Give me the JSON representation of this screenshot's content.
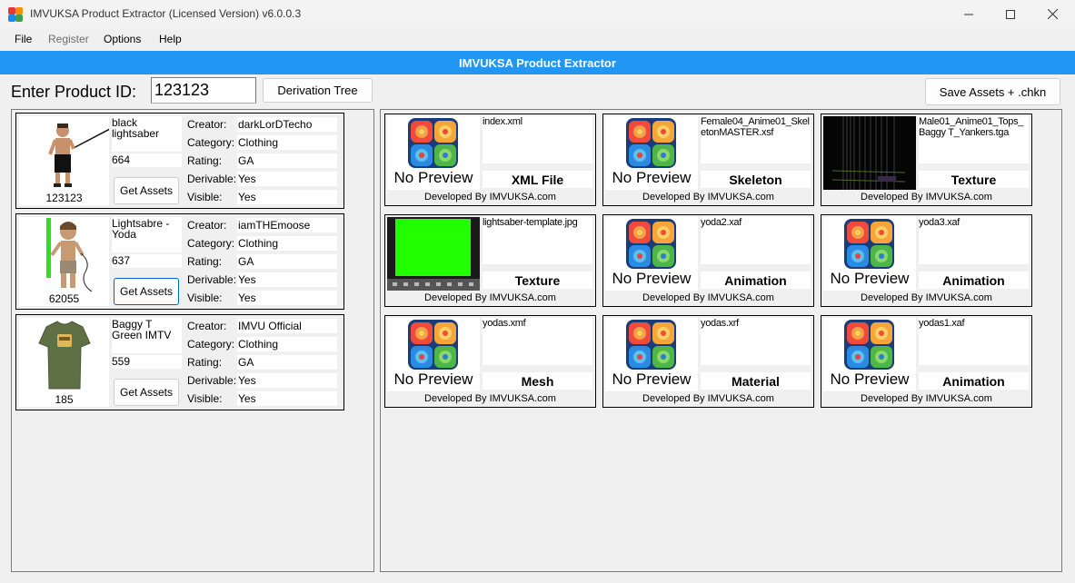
{
  "window": {
    "title": "IMVUKSA Product Extractor (Licensed Version) v6.0.0.3",
    "icon": "app-logo-icon",
    "controls": [
      "minimize-icon",
      "maximize-icon",
      "close-icon"
    ]
  },
  "menu": {
    "file": "File",
    "register": "Register",
    "options": "Options",
    "help": "Help"
  },
  "header": {
    "title": "IMVUKSA Product Extractor",
    "color": "#2196f3"
  },
  "toolbar": {
    "product_id_label": "Enter Product ID:",
    "product_id_value": "123123",
    "derivation_tree": "Derivation Tree",
    "save_assets": "Save Assets + .chkn"
  },
  "labels": {
    "creator": "Creator:",
    "category": "Category:",
    "rating": "Rating:",
    "derivable": "Derivable:",
    "visible": "Visible:",
    "get_assets": "Get Assets",
    "no_preview": "No Preview",
    "developed_by": "Developed By IMVUKSA.com"
  },
  "products": [
    {
      "id": "123123",
      "name": "black lightsaber",
      "count": "664",
      "creator": "darkLorDTecho",
      "category": "Clothing",
      "rating": "GA",
      "derivable": "Yes",
      "visible": "Yes",
      "thumb": "avatar-with-black-lightsaber"
    },
    {
      "id": "62055",
      "name": "Lightsabre - Yoda",
      "count": "637",
      "creator": "iamTHEmoose",
      "category": "Clothing",
      "rating": "GA",
      "derivable": "Yes",
      "visible": "Yes",
      "thumb": "avatar-with-green-lightsaber"
    },
    {
      "id": "185",
      "name": "Baggy T Green IMTV",
      "count": "559",
      "creator": "IMVU Official",
      "category": "Clothing",
      "rating": "GA",
      "derivable": "Yes",
      "visible": "Yes",
      "thumb": "green-tshirt"
    }
  ],
  "assets": [
    {
      "name": "index.xml",
      "type": "XML File",
      "preview": "no-preview"
    },
    {
      "name": "Female04_Anime01_SkeletonMASTER.xsf",
      "type": "Skeleton",
      "preview": "no-preview"
    },
    {
      "name": "Male01_Anime01_Tops_Baggy T_Yankers.tga",
      "type": "Texture",
      "preview": "dark-texture"
    },
    {
      "name": "lightsaber-template.jpg",
      "type": "Texture",
      "preview": "green-texture"
    },
    {
      "name": "yoda2.xaf",
      "type": "Animation",
      "preview": "no-preview"
    },
    {
      "name": "yoda3.xaf",
      "type": "Animation",
      "preview": "no-preview"
    },
    {
      "name": "yodas.xmf",
      "type": "Mesh",
      "preview": "no-preview"
    },
    {
      "name": "yodas.xrf",
      "type": "Material",
      "preview": "no-preview"
    },
    {
      "name": "yodas1.xaf",
      "type": "Animation",
      "preview": "no-preview"
    }
  ]
}
